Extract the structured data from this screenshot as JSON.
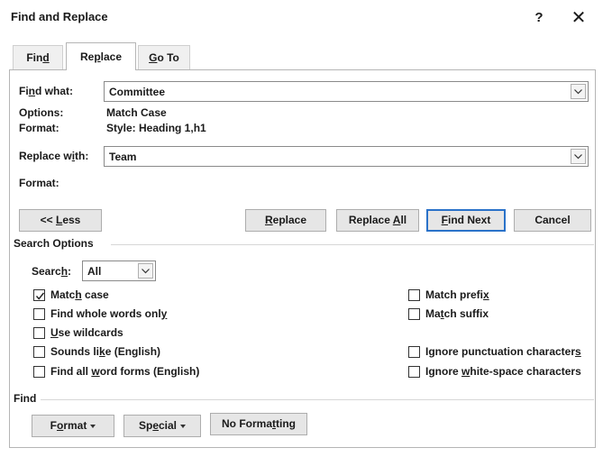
{
  "window": {
    "title": "Find and Replace",
    "help_glyph": "?",
    "close_glyph": "✕"
  },
  "tabs": [
    {
      "pre": "Fin",
      "key": "d",
      "post": "",
      "active": false
    },
    {
      "pre": "Re",
      "key": "p",
      "post": "lace",
      "active": true
    },
    {
      "pre": "",
      "key": "G",
      "post": "o To",
      "active": false
    }
  ],
  "find": {
    "label_pre": "Fi",
    "label_key": "n",
    "label_post": "d what:",
    "value": "Committee",
    "options_label": "Options:",
    "options_value": "Match Case",
    "format_label": "Format:",
    "format_value": "Style: Heading 1,h1"
  },
  "replace": {
    "label_pre": "Replace w",
    "label_key": "i",
    "label_post": "th:",
    "value": "Team",
    "format_label": "Format:"
  },
  "buttons": {
    "less": {
      "pre": "<< ",
      "key": "L",
      "post": "ess"
    },
    "replace": {
      "pre": "",
      "key": "R",
      "post": "eplace"
    },
    "replace_all": {
      "pre": "Replace ",
      "key": "A",
      "post": "ll"
    },
    "find_next": {
      "pre": "",
      "key": "F",
      "post": "ind Next"
    },
    "cancel": {
      "label": "Cancel"
    }
  },
  "search_options": {
    "title": "Search Options",
    "search_label_pre": "Searc",
    "search_label_key": "h",
    "search_label_post": ":",
    "search_value": "All",
    "left_checks": [
      {
        "pre": "Matc",
        "key": "h",
        "post": " case",
        "checked": true
      },
      {
        "pre": "Find whole words onl",
        "key": "y",
        "post": "",
        "checked": false
      },
      {
        "pre": "",
        "key": "U",
        "post": "se wildcards",
        "checked": false
      },
      {
        "pre": "Sounds li",
        "key": "k",
        "post": "e (English)",
        "checked": false
      },
      {
        "pre": "Find all ",
        "key": "w",
        "post": "ord forms (English)",
        "checked": false
      }
    ],
    "right_checks": [
      {
        "pre": "Match prefi",
        "key": "x",
        "post": "",
        "checked": false
      },
      {
        "pre": "Ma",
        "key": "t",
        "post": "ch suffix",
        "checked": false
      },
      {
        "pre": "Ignore punctuation character",
        "key": "s",
        "post": "",
        "checked": false
      },
      {
        "pre": "Ignore ",
        "key": "w",
        "post": "hite-space characters",
        "checked": false
      }
    ]
  },
  "find_section": {
    "title": "Find",
    "format_btn": {
      "pre": "F",
      "key": "o",
      "post": "rmat"
    },
    "special_btn": {
      "pre": "Sp",
      "key": "e",
      "post": "cial"
    },
    "no_formatting_btn": {
      "pre": "No Forma",
      "key": "t",
      "post": "ting"
    }
  }
}
